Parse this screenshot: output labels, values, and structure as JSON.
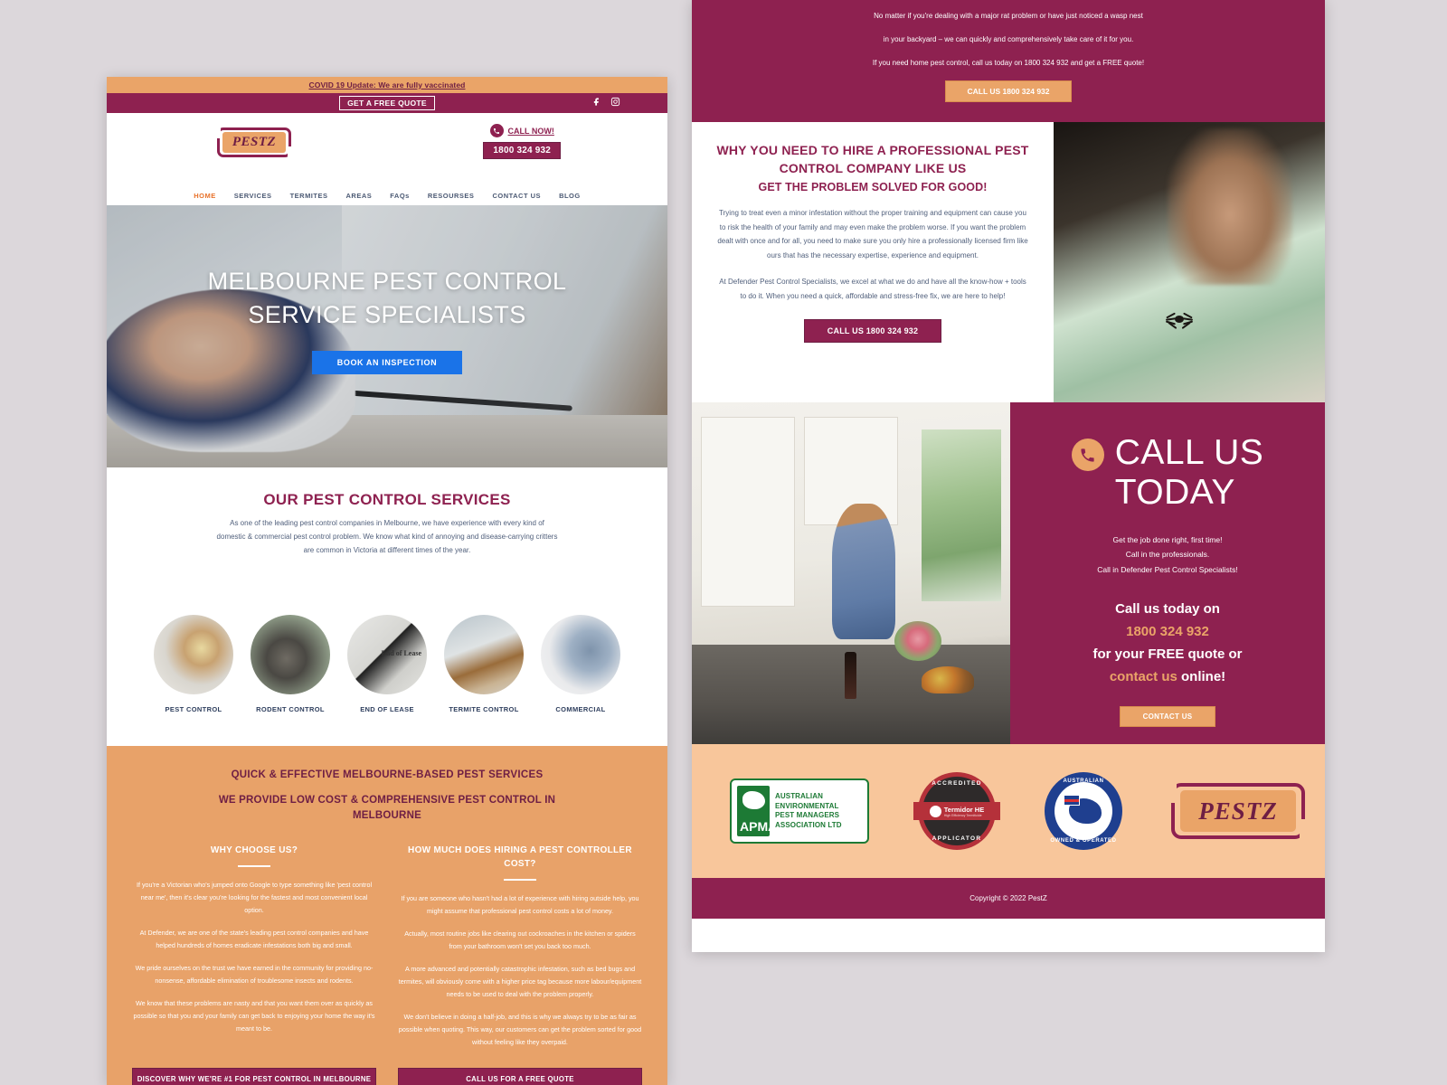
{
  "left": {
    "covid_bar": {
      "text": "COVID 19 Update: We are fully vaccinated"
    },
    "quote_bar": {
      "button": "GET A FREE QUOTE",
      "facebook_icon": "facebook-icon",
      "instagram_icon": "instagram-icon"
    },
    "header": {
      "logo_text": "PESTZ",
      "call_now_label": "CALL NOW!",
      "phone": "1800 324 932",
      "phone_icon": "phone-icon"
    },
    "nav": [
      {
        "label": "HOME",
        "active": true
      },
      {
        "label": "SERVICES",
        "active": false
      },
      {
        "label": "TERMITES",
        "active": false
      },
      {
        "label": "AREAS",
        "active": false
      },
      {
        "label": "FAQs",
        "active": false
      },
      {
        "label": "RESOURSES",
        "active": false
      },
      {
        "label": "CONTACT US",
        "active": false
      },
      {
        "label": "BLOG",
        "active": false
      }
    ],
    "hero": {
      "line1": "MELBOURNE PEST CONTROL",
      "line2": "SERVICE SPECIALISTS",
      "button": "BOOK AN INSPECTION"
    },
    "services": {
      "title": "OUR PEST CONTROL SERVICES",
      "body": "As one of the leading pest control companies in Melbourne, we have experience with every kind of domestic & commercial pest control problem. We know what kind of annoying and disease-carrying critters are common in Victoria at different times of the year.",
      "items": [
        {
          "label": "PEST CONTROL"
        },
        {
          "label": "RODENT CONTROL"
        },
        {
          "label": "END OF LEASE",
          "overlay": "End of Lease"
        },
        {
          "label": "TERMITE CONTROL"
        },
        {
          "label": "COMMERCIAL"
        }
      ]
    },
    "orange": {
      "heading1": "QUICK & EFFECTIVE MELBOURNE-BASED PEST SERVICES",
      "heading2": "WE PROVIDE LOW COST & COMPREHENSIVE PEST CONTROL IN MELBOURNE",
      "col_left": {
        "title": "WHY CHOOSE US?",
        "p1": "If you're a Victorian who's jumped onto Google to type something like 'pest control near me', then it's clear you're looking for the fastest and most convenient local option.",
        "p2": "At Defender, we are one of the state's leading pest control companies and have helped hundreds of homes eradicate infestations both big and small.",
        "p3": "We pride ourselves on the trust we have earned in the community for providing no-nonsense, affordable elimination of troublesome insects and rodents.",
        "p4": "We know that these problems are nasty and that you want them over as quickly as possible so that you and your family can get back to enjoying your home the way it's meant to be.",
        "button": "DISCOVER WHY WE'RE #1 FOR PEST CONTROL IN MELBOURNE"
      },
      "col_right": {
        "title": "HOW MUCH DOES HIRING A PEST CONTROLLER COST?",
        "p1": "If you are someone who hasn't had a lot of experience with hiring outside help, you might assume that professional pest control costs a lot of money.",
        "p2": "Actually, most routine jobs like clearing out cockroaches in the kitchen or spiders from your bathroom won't set you back too much.",
        "p3": "A more advanced and potentially catastrophic infestation, such as bed bugs and termites, will obviously come with a higher price tag because more labour/equipment needs to be used to deal with the problem properly.",
        "p4": "We don't believe in doing a half-job, and this is why we always try to be as fair as possible when quoting. This way, our customers can get the problem sorted for good without feeling like they overpaid.",
        "button": "CALL US FOR A FREE QUOTE"
      }
    }
  },
  "right": {
    "top": {
      "p1": "No matter if you're dealing with a major rat problem or have just noticed a wasp nest",
      "p2": "in your backyard – we can quickly and comprehensively take care of it for you.",
      "p3": "If you need home pest control, call us today on 1800 324 932 and get a FREE quote!",
      "button": "CALL US 1800 324 932"
    },
    "why": {
      "heading": "WHY YOU NEED TO HIRE A PROFESSIONAL PEST CONTROL COMPANY LIKE US",
      "subheading": "GET THE PROBLEM SOLVED FOR GOOD!",
      "p1": "Trying to treat even a minor infestation without the proper training and equipment can cause you to risk the health of your family and may even make the problem worse. If you want the problem dealt with once and for all, you need to make sure you only hire a professionally licensed firm like ours that has the necessary expertise, experience and equipment.",
      "p2": "At Defender Pest Control Specialists, we excel at what we do and have all the know-how + tools to do it. When you need a quick, affordable and stress-free fix, we are here to help!",
      "button": "CALL US 1800 324 932"
    },
    "call_today": {
      "title_line1": "CALL US",
      "title_line2": "TODAY",
      "phone_icon": "phone-icon",
      "s1": "Get the job done right, first time!",
      "s2": "Call in the professionals.",
      "s3": "Call in Defender Pest Control Specialists!",
      "b1": "Call us today on",
      "b2_number": "1800 324 932",
      "b3": "for your FREE quote or",
      "b4_link": "contact us",
      "b4_rest": " online!",
      "button": "CONTACT US"
    },
    "badges": {
      "apma": {
        "initials": "APMA",
        "line1": "AUSTRALIAN",
        "line2": "ENVIRONMENTAL",
        "line3": "PEST MANAGERS",
        "line4": "ASSOCIATION LTD"
      },
      "termidor": {
        "top": "ACCREDITED",
        "center": "Termidor HE",
        "center_sub": "High Efficiency Termiticide",
        "bottom": "APPLICATOR"
      },
      "australian": {
        "top": "AUSTRALIAN",
        "bottom": "OWNED & OPERATED"
      },
      "logo_text": "PESTZ"
    },
    "copyright": "Copyright © 2022 PestZ"
  },
  "colors": {
    "maroon": "#8e2150",
    "orange": "#e8a269",
    "peach": "#f8c69b",
    "blue": "#1a73e8",
    "nav_active": "#e8722b"
  }
}
